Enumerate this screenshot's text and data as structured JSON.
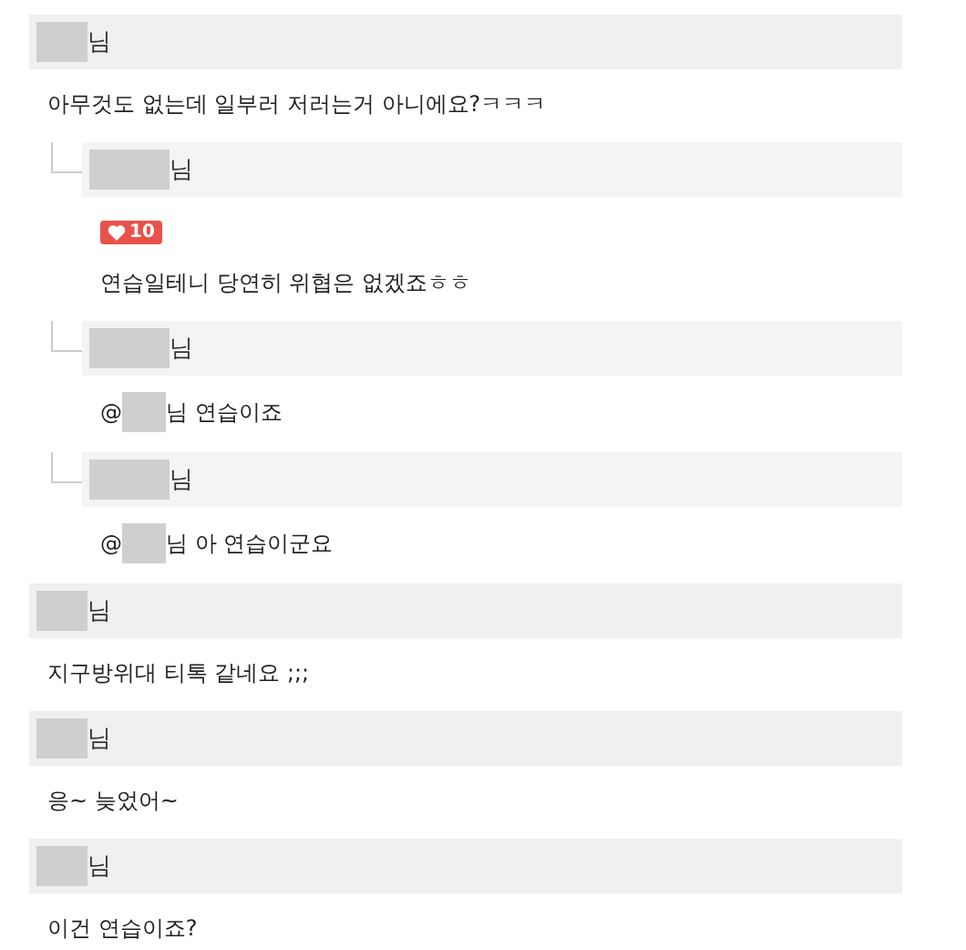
{
  "comments": [
    {
      "author_suffix": "님",
      "text": "아무것도 없는데 일부러 저러는거 아니에요?ㅋㅋㅋ",
      "children": [
        {
          "author_suffix": "님",
          "likes": "10",
          "text": "연습일테니 당연히 위협은 없겠죠ㅎㅎ"
        },
        {
          "author_suffix": "님",
          "mention": {
            "prefix": "@",
            "rest": "님 연습이죠"
          }
        },
        {
          "author_suffix": "님",
          "mention": {
            "prefix": "@",
            "rest": "님 아 연습이군요"
          }
        }
      ]
    },
    {
      "author_suffix": "님",
      "text": "지구방위대 티톡 같네요 ;;;"
    },
    {
      "author_suffix": "님",
      "text": "응~ 늦었어~"
    },
    {
      "author_suffix": "님",
      "text": "이건 연습이죠?"
    }
  ]
}
